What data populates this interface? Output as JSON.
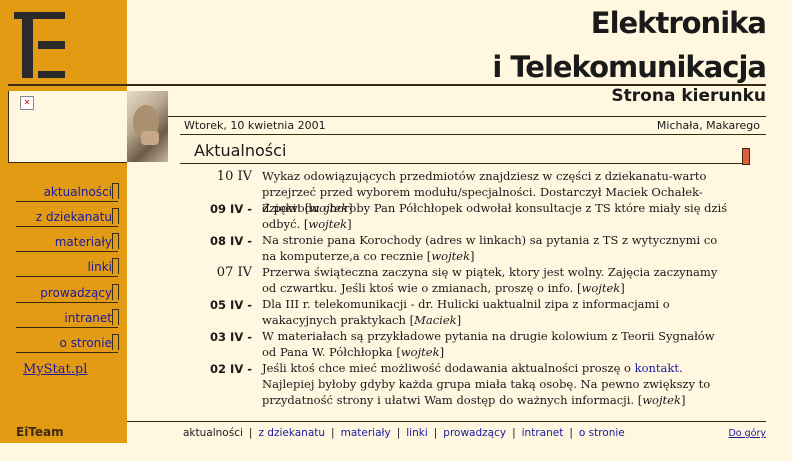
{
  "header": {
    "title_line1": "Elektronika",
    "title_line2": "i Telekomunikacja",
    "subtitle": "Strona kierunku"
  },
  "date_bar": {
    "date": "Wtorek, 10 kwietnia 2001",
    "name_days": "Michała, Makarego"
  },
  "section_title": "Aktualności",
  "sidebar": {
    "nav": [
      {
        "label": "aktualności"
      },
      {
        "label": "z dziekanatu"
      },
      {
        "label": "materiały"
      },
      {
        "label": "linki"
      },
      {
        "label": "prowadzący"
      },
      {
        "label": "intranet"
      },
      {
        "label": "o stronie"
      }
    ],
    "mystat": "MyStat.pl",
    "team": "EiTeam"
  },
  "news": [
    {
      "date": "10 IV",
      "style": "plain",
      "text": "Wykaz odowiązujących przedmiotów znajdziesz w części z dziekanatu-warto przejrzeć przed wyborem modułu/specjalności. Dostarczył Maciek Ochałek-dzięki!",
      "author": "wojtek"
    },
    {
      "date": "09 IV -",
      "style": "bold",
      "text": "Z powodu choroby Pan Półchłopek odwołał konsultacje z TS które miały się dziś odbyć.",
      "author": "wojtek"
    },
    {
      "date": "08 IV -",
      "style": "bold",
      "text": "Na stronie pana Korochody (adres w linkach) sa pytania z TS z wytycznymi co na komputerze,a co recznie",
      "author": "wojtek"
    },
    {
      "date": "07 IV",
      "style": "plain",
      "text": "Przerwa świąteczna zaczyna się w piątek, ktory jest wolny. Zajęcia zaczynamy od czwartku. Jeśli ktoś wie o zmianach, proszę o info.",
      "author": "wojtek"
    },
    {
      "date": "05 IV -",
      "style": "bold",
      "text": "Dla III r. telekomunikacji - dr. Hulicki uaktualnil zipa z informacjami o wakacyjnych praktykach",
      "author": "Maciek"
    },
    {
      "date": "03 IV -",
      "style": "bold",
      "text": "W materiałach są przykładowe pytania na drugie kolowium z Teorii Sygnałów od Pana W. Półchłopka",
      "author": "wojtek"
    },
    {
      "date": "02 IV -",
      "style": "bold",
      "text_before": "Jeśli ktoś chce mieć możliwość dodawania aktualności proszę o ",
      "link": "kontakt",
      "text_after": ". Najlepiej byłoby gdyby każda grupa miała taką osobę. Na pewno zwiększy to przydatność strony i ułatwi Wam dostęp do ważnych informacji.",
      "author": "wojtek"
    }
  ],
  "footer": {
    "items": [
      "aktualności",
      "z dziekanatu",
      "materiały",
      "linki",
      "prowadzący",
      "intranet",
      "o stronie"
    ],
    "separator": "|",
    "top_link": "Do góry"
  },
  "colors": {
    "sidebar": "#e39b14",
    "background": "#fff7df",
    "link": "#1a1aa0",
    "marker": "#d9603a"
  }
}
